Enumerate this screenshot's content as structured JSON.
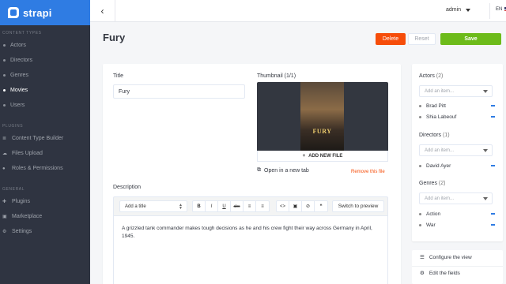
{
  "brand": {
    "name": "strapi"
  },
  "sidebar": {
    "sections": [
      {
        "title": "CONTENT TYPES",
        "items": [
          {
            "label": "Actors",
            "active": false
          },
          {
            "label": "Directors",
            "active": false
          },
          {
            "label": "Genres",
            "active": false
          },
          {
            "label": "Movies",
            "active": true
          },
          {
            "label": "Users",
            "active": false
          }
        ]
      },
      {
        "title": "PLUGINS",
        "items": [
          {
            "label": "Content Type Builder",
            "icon": "layers-icon"
          },
          {
            "label": "Files Upload",
            "icon": "cloud-upload-icon"
          },
          {
            "label": "Roles & Permissions",
            "icon": "users-icon"
          }
        ]
      },
      {
        "title": "GENERAL",
        "items": [
          {
            "label": "Plugins",
            "icon": "puzzle-icon"
          },
          {
            "label": "Marketplace",
            "icon": "shopping-basket-icon"
          },
          {
            "label": "Settings",
            "icon": "gear-icon"
          }
        ]
      }
    ]
  },
  "header": {
    "back_icon": "chevron-left-icon",
    "user": "admin",
    "lang": "EN"
  },
  "page": {
    "title": "Fury"
  },
  "actions": {
    "delete": "Delete",
    "reset": "Reset",
    "save": "Save"
  },
  "form": {
    "title_label": "Title",
    "title_value": "Fury",
    "thumbnail_label": "Thumbnail (1/1)",
    "poster_text": "FURY",
    "add_file": "ADD NEW FILE",
    "open_new_tab": "Open in a new tab",
    "remove_file": "Remove this file",
    "description_label": "Description",
    "heading_select": "Add a title",
    "toolbar": [
      "B",
      "I",
      "U",
      "abc",
      "≡",
      "≡",
      "<>",
      "▣",
      "⊘",
      "❝"
    ],
    "preview_button": "Switch to preview",
    "description_text": "A grizzled tank commander makes tough decisions as he and his crew fight their way across Germany in April, 1945."
  },
  "relations": {
    "actors": {
      "label": "Actors",
      "count": "(2)",
      "placeholder": "Add an item...",
      "items": [
        "Brad Pitt",
        "Shia Labeouf"
      ]
    },
    "directors": {
      "label": "Directors",
      "count": "(1)",
      "placeholder": "Add an item...",
      "items": [
        "David Ayer"
      ]
    },
    "genres": {
      "label": "Genres",
      "count": "(2)",
      "placeholder": "Add an item...",
      "items": [
        "Action",
        "War"
      ]
    }
  },
  "side_links": {
    "configure": "Configure the view",
    "edit_fields": "Edit the fields"
  },
  "colors": {
    "sidebar_bg": "#2f3441",
    "brand": "#2f7ce3",
    "delete": "#f64d0a",
    "save": "#6dbb1a"
  }
}
